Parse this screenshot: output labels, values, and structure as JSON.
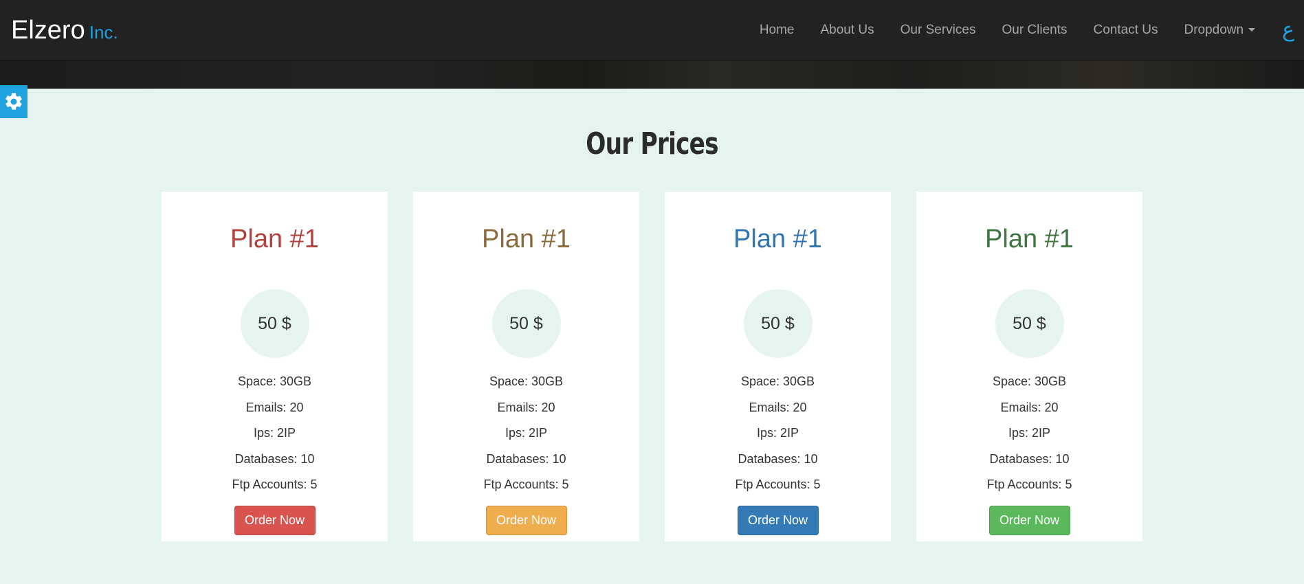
{
  "navbar": {
    "brand": "Elzero",
    "brand_sub": "Inc.",
    "links": [
      "Home",
      "About Us",
      "Our Services",
      "Our Clients",
      "Contact Us"
    ],
    "dropdown_label": "Dropdown",
    "lang_toggle": "ع"
  },
  "settings": {
    "icon": "gear-icon"
  },
  "pricing": {
    "title": "Our Prices",
    "plans": [
      {
        "name": "Plan #1",
        "name_color": "#b3423f",
        "price": "50 $",
        "features": [
          "Space: 30GB",
          "Emails: 20",
          "Ips: 2IP",
          "Databases: 10",
          "Ftp Accounts: 5"
        ],
        "button": "Order Now",
        "button_color": "#d9534f"
      },
      {
        "name": "Plan #1",
        "name_color": "#8b6b3c",
        "price": "50 $",
        "features": [
          "Space: 30GB",
          "Emails: 20",
          "Ips: 2IP",
          "Databases: 10",
          "Ftp Accounts: 5"
        ],
        "button": "Order Now",
        "button_color": "#f0ad4e"
      },
      {
        "name": "Plan #1",
        "name_color": "#3175b5",
        "price": "50 $",
        "features": [
          "Space: 30GB",
          "Emails: 20",
          "Ips: 2IP",
          "Databases: 10",
          "Ftp Accounts: 5"
        ],
        "button": "Order Now",
        "button_color": "#337ab7"
      },
      {
        "name": "Plan #1",
        "name_color": "#3d763e",
        "price": "50 $",
        "features": [
          "Space: 30GB",
          "Emails: 20",
          "Ips: 2IP",
          "Databases: 10",
          "Ftp Accounts: 5"
        ],
        "button": "Order Now",
        "button_color": "#5cb85c"
      }
    ]
  }
}
